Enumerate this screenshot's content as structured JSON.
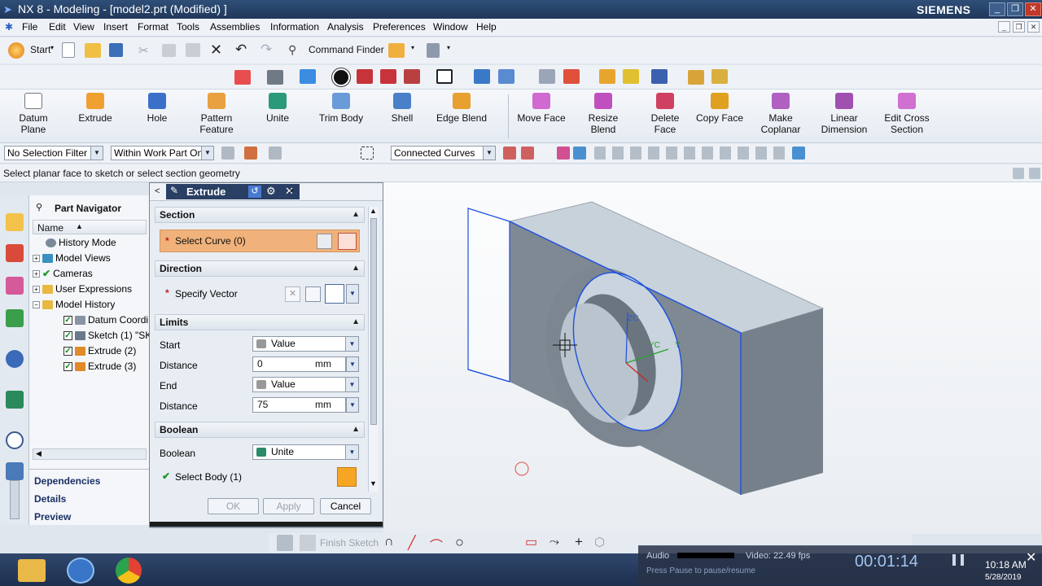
{
  "window": {
    "title": "NX 8 - Modeling - [model2.prt (Modified) ]",
    "brand": "SIEMENS"
  },
  "menu": [
    "File",
    "Edit",
    "View",
    "Insert",
    "Format",
    "Tools",
    "Assemblies",
    "Information",
    "Analysis",
    "Preferences",
    "Window",
    "Help"
  ],
  "standard_toolbar": {
    "start_label": "Start",
    "command_finder_label": "Command Finder"
  },
  "ribbon": {
    "features": [
      {
        "label": "Datum\nPlane"
      },
      {
        "label": "Extrude"
      },
      {
        "label": "Hole"
      },
      {
        "label": "Pattern\nFeature"
      },
      {
        "label": "Unite"
      },
      {
        "label": "Trim Body"
      },
      {
        "label": "Shell"
      },
      {
        "label": "Edge Blend"
      }
    ],
    "sync": [
      {
        "label": "Move Face"
      },
      {
        "label": "Resize\nBlend"
      },
      {
        "label": "Delete\nFace"
      },
      {
        "label": "Copy Face"
      },
      {
        "label": "Make\nCoplanar"
      },
      {
        "label": "Linear\nDimension"
      },
      {
        "label": "Edit Cross\nSection"
      }
    ]
  },
  "filters": {
    "selection_filter": "No Selection Filter",
    "scope": "Within Work Part Onl",
    "curve_rule": "Connected Curves"
  },
  "status_prompt": "Select planar face to sketch or select section geometry",
  "part_navigator": {
    "title": "Part Navigator",
    "column_name": "Name",
    "items": [
      {
        "label": "History Mode"
      },
      {
        "label": "Model Views"
      },
      {
        "label": "Cameras"
      },
      {
        "label": "User Expressions"
      },
      {
        "label": "Model History"
      },
      {
        "label": "Datum Coordi"
      },
      {
        "label": "Sketch (1) \"SK"
      },
      {
        "label": "Extrude (2)"
      },
      {
        "label": "Extrude (3)"
      }
    ],
    "panels": [
      "Dependencies",
      "Details",
      "Preview"
    ]
  },
  "extrude_dialog": {
    "title": "Extrude",
    "section": {
      "header": "Section",
      "select_curve": "Select Curve (0)"
    },
    "direction": {
      "header": "Direction",
      "specify_vector": "Specify Vector"
    },
    "limits": {
      "header": "Limits",
      "start_label": "Start",
      "start_option": "Value",
      "start_distance_label": "Distance",
      "start_distance": "0",
      "end_label": "End",
      "end_option": "Value",
      "end_distance_label": "Distance",
      "end_distance": "75",
      "unit": "mm"
    },
    "boolean": {
      "header": "Boolean",
      "label": "Boolean",
      "option": "Unite",
      "select_body": "Select Body (1)"
    },
    "buttons": {
      "ok": "OK",
      "apply": "Apply",
      "cancel": "Cancel"
    }
  },
  "viewport": {
    "triad": {
      "zc": "ZC",
      "yc": "YC",
      "y": "Y"
    }
  },
  "sketch_toolbar": {
    "finish_sketch": "Finish Sketch"
  },
  "recorder": {
    "audio_label": "Audio",
    "video_label": "Video: 22.49 fps",
    "elapsed": "00:01:14",
    "hint": "Press Pause to pause/resume"
  },
  "taskbar": {
    "time": "10:18 AM",
    "date": "5/28/2019"
  },
  "colors": {
    "accent": "#f0b27a",
    "title_bar": "#2a4468",
    "edge_highlight": "#1f4fe0"
  }
}
